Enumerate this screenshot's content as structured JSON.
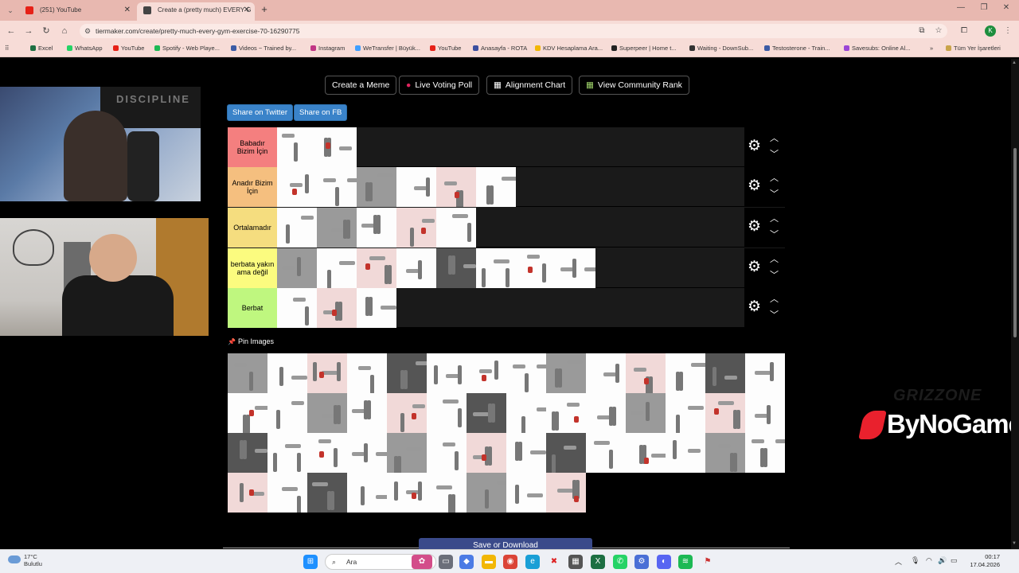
{
  "browser": {
    "tabs": [
      {
        "title": "(251) YouTube",
        "active": false,
        "favicon_color": "#e62117"
      },
      {
        "title": "Create a (pretty much) EVERY G",
        "active": true,
        "favicon_color": "#444444"
      }
    ],
    "url": "tiermaker.com/create/pretty-much-every-gym-exercise-70-16290775",
    "bookmarks": [
      {
        "label": "Excel",
        "color": "#1d6f42"
      },
      {
        "label": "WhatsApp",
        "color": "#25d366"
      },
      {
        "label": "YouTube",
        "color": "#e62117"
      },
      {
        "label": "Spotify - Web Playe...",
        "color": "#1db954"
      },
      {
        "label": "Videos ~ Trained by...",
        "color": "#3b5ba5"
      },
      {
        "label": "Instagram",
        "color": "#c13584"
      },
      {
        "label": "WeTransfer | Büyük...",
        "color": "#409fff"
      },
      {
        "label": "YouTube",
        "color": "#e62117"
      },
      {
        "label": "Anasayfa - ROTA",
        "color": "#3c4fa0"
      },
      {
        "label": "KDV Hesaplama Ara...",
        "color": "#f2b705"
      },
      {
        "label": "Superpeer | Home t...",
        "color": "#222222"
      },
      {
        "label": "Waiting - DownSub...",
        "color": "#333333"
      },
      {
        "label": "Testosterone - Train...",
        "color": "#3b5ba5"
      },
      {
        "label": "Savesubs: Online Al...",
        "color": "#9a46d6"
      }
    ],
    "all_bookmarks": "Tüm Yer İşaretleri",
    "profile_initial": "K"
  },
  "toolbar": {
    "create_meme": "Create a Meme",
    "live_voting": "Live Voting Poll",
    "alignment_chart": "Alignment Chart",
    "community_rank": "View Community Rank",
    "share_twitter": "Share on Twitter",
    "share_fb": "Share on FB"
  },
  "tiers": [
    {
      "label": "Babadır Bizim İçin",
      "color": "#f47f7f",
      "count": 2
    },
    {
      "label": "Anadır Bizim İçin",
      "color": "#f5bf7f",
      "count": 6
    },
    {
      "label": "Ortalamadır",
      "color": "#f5dd7f",
      "count": 5
    },
    {
      "label": "berbata yakın ama değil",
      "color": "#fbfb7f",
      "count": 8
    },
    {
      "label": "Berbat",
      "color": "#bff77f",
      "count": 3
    }
  ],
  "pin_images": "Pin Images",
  "pool": {
    "rows": 4,
    "per_row": 14,
    "last_row": 9
  },
  "save_button": "Save or Download",
  "watermark": {
    "brand": "ByNoGame",
    "faded": "GRIZZONE"
  },
  "webcam_top": {
    "banner_text": "DISCIPLINE"
  },
  "taskbar": {
    "weather_temp": "17°C",
    "weather_desc": "Bulutlu",
    "search_placeholder": "Ara",
    "time": "00:17",
    "date": "17.04.2026"
  }
}
